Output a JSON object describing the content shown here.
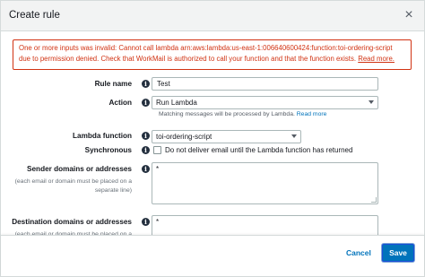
{
  "header": {
    "title": "Create rule",
    "close_glyph": "×"
  },
  "error": {
    "message": "One or more inputs was invalid: Cannot call lambda arn:aws:lambda:us-east-1:006640600424:function:toi-ordering-script due to permission denied. Check that WorkMail is authorized to call your function and that the function exists.",
    "link_text": "Read more."
  },
  "form": {
    "rule_name": {
      "label": "Rule name",
      "value": "Test"
    },
    "action": {
      "label": "Action",
      "value": "Run Lambda",
      "hint": "Matching messages will be processed by Lambda.",
      "hint_link": "Read more"
    },
    "lambda_function": {
      "label": "Lambda function",
      "value": "toi-ordering-script"
    },
    "synchronous": {
      "label": "Synchronous",
      "checkbox_label": "Do not deliver email until the Lambda function has returned",
      "checked": false
    },
    "sender": {
      "label": "Sender domains or addresses",
      "help": "(each email or domain must be placed on a separate line)",
      "value": "*"
    },
    "destination": {
      "label": "Destination domains or addresses",
      "help": "(each email or domain must be placed on a separate line)",
      "value": "*"
    }
  },
  "footer": {
    "cancel_label": "Cancel",
    "save_label": "Save"
  },
  "icons": {
    "info": "info-icon",
    "close": "close-icon",
    "caret": "chevron-down-icon"
  },
  "colors": {
    "error": "#d13212",
    "link": "#0073bb",
    "primary_button": "#0073bb",
    "header_bg": "#f2f3f3"
  }
}
